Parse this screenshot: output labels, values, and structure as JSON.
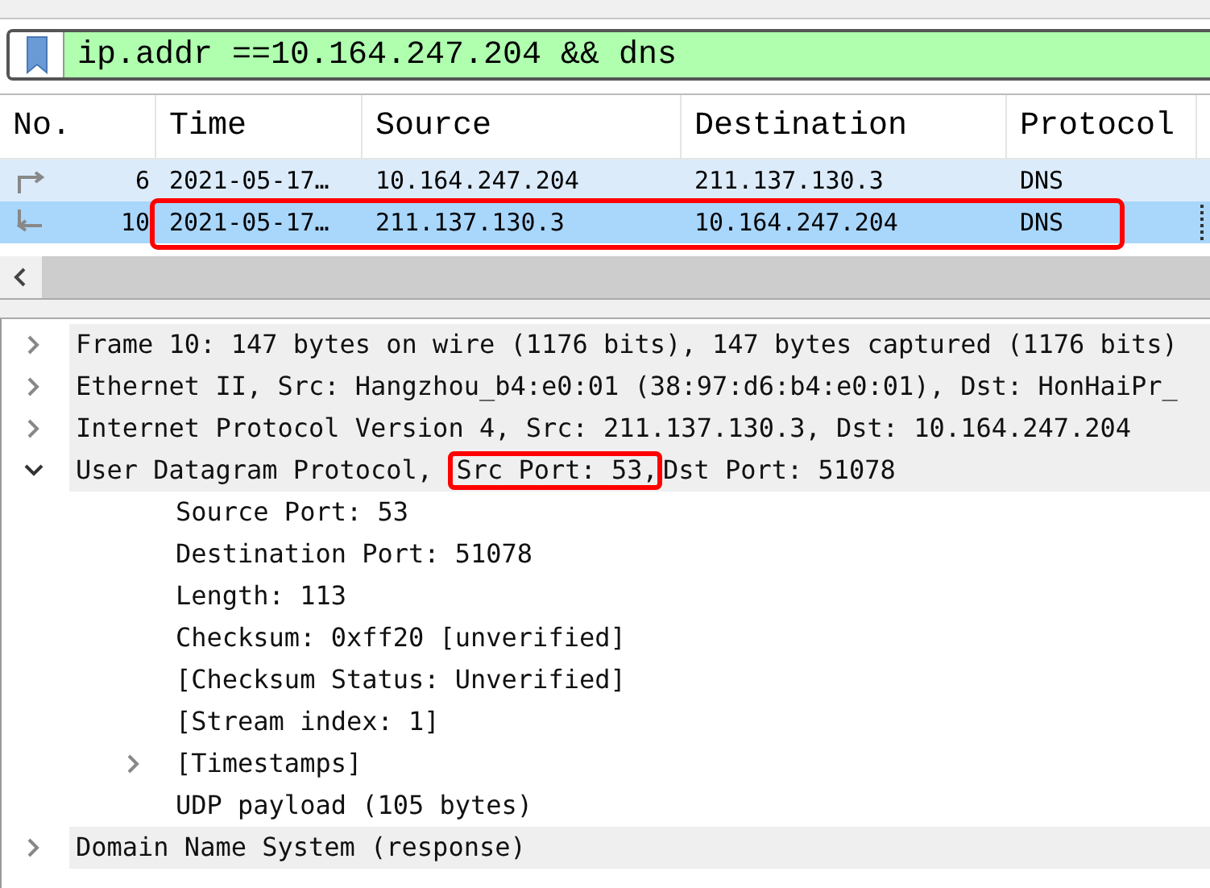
{
  "filter": {
    "text": "ip.addr ==10.164.247.204 && dns"
  },
  "columns": [
    "No.",
    "Time",
    "Source",
    "Destination",
    "Protocol"
  ],
  "packets": [
    {
      "no": "6",
      "time": "2021-05-17…",
      "source": "10.164.247.204",
      "destination": "211.137.130.3",
      "protocol": "DNS",
      "selected": false,
      "annotated": false,
      "kind": "request"
    },
    {
      "no": "10",
      "time": "2021-05-17…",
      "source": "211.137.130.3",
      "destination": "10.164.247.204",
      "protocol": "DNS",
      "selected": true,
      "annotated": true,
      "kind": "response"
    }
  ],
  "details": [
    {
      "kind": "branch",
      "expanded": false,
      "text": "Frame 10: 147 bytes on wire (1176 bits), 147 bytes captured (1176 bits)"
    },
    {
      "kind": "branch",
      "expanded": false,
      "text": "Ethernet II, Src: Hangzhou_b4:e0:01 (38:97:d6:b4:e0:01), Dst: HonHaiPr_"
    },
    {
      "kind": "branch",
      "expanded": false,
      "text": "Internet Protocol Version 4, Src: 211.137.130.3, Dst: 10.164.247.204"
    },
    {
      "kind": "branch",
      "expanded": true,
      "text": "User Datagram Protocol,",
      "highlight": "Src Port: 53,",
      "text_after": "Dst Port: 51078",
      "children": [
        {
          "kind": "leaf",
          "text": "Source Port: 53"
        },
        {
          "kind": "leaf",
          "text": "Destination Port: 51078"
        },
        {
          "kind": "leaf",
          "text": "Length: 113"
        },
        {
          "kind": "leaf",
          "text": "Checksum: 0xff20 [unverified]"
        },
        {
          "kind": "leaf",
          "text": "[Checksum Status: Unverified]"
        },
        {
          "kind": "leaf",
          "text": "[Stream index: 1]"
        },
        {
          "kind": "branch",
          "expanded": false,
          "text": "[Timestamps]"
        },
        {
          "kind": "leaf",
          "text": "UDP payload (105 bytes)"
        }
      ]
    },
    {
      "kind": "branch",
      "expanded": false,
      "text": "Domain Name System (response)"
    }
  ]
}
